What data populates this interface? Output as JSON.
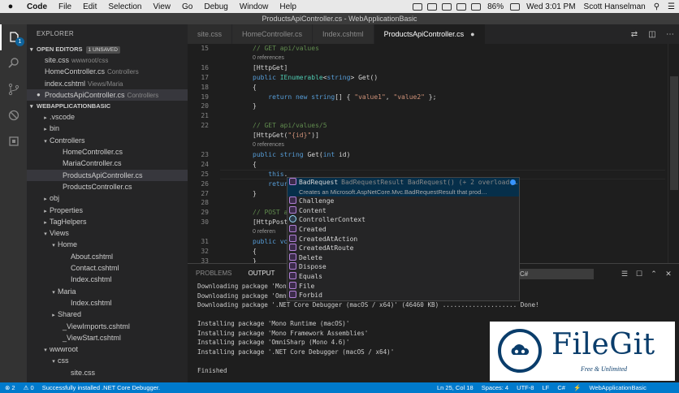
{
  "menubar": {
    "apple": "",
    "items": [
      "Code",
      "File",
      "Edit",
      "Selection",
      "View",
      "Go",
      "Debug",
      "Window",
      "Help"
    ],
    "battery": "86%",
    "clock": "Wed 3:01 PM",
    "user": "Scott Hanselman"
  },
  "window": {
    "title": "ProductsApiController.cs - WebApplicationBasic"
  },
  "activity": {
    "badge": "1"
  },
  "sidebar": {
    "title": "EXPLORER",
    "open_editors": {
      "header": "OPEN EDITORS",
      "badge": "1 UNSAVED",
      "items": [
        {
          "name": "site.css",
          "path": "wwwroot/css"
        },
        {
          "name": "HomeController.cs",
          "path": "Controllers"
        },
        {
          "name": "index.cshtml",
          "path": "Views/Maria"
        },
        {
          "name": "ProductsApiController.cs",
          "path": "Controllers"
        }
      ]
    },
    "project": {
      "header": "WEBAPPLICATIONBASIC",
      "items": [
        {
          "label": ".vscode",
          "chev": "▸"
        },
        {
          "label": "bin",
          "chev": "▸"
        },
        {
          "label": "Controllers",
          "chev": "▾"
        },
        {
          "label": "HomeController.cs",
          "chev": ""
        },
        {
          "label": "MariaController.cs",
          "chev": ""
        },
        {
          "label": "ProductsApiController.cs",
          "chev": ""
        },
        {
          "label": "ProductsController.cs",
          "chev": ""
        },
        {
          "label": "obj",
          "chev": "▸"
        },
        {
          "label": "Properties",
          "chev": "▸"
        },
        {
          "label": "TagHelpers",
          "chev": "▸"
        },
        {
          "label": "Views",
          "chev": "▾"
        },
        {
          "label": "Home",
          "chev": "▾"
        },
        {
          "label": "About.cshtml",
          "chev": ""
        },
        {
          "label": "Contact.cshtml",
          "chev": ""
        },
        {
          "label": "Index.cshtml",
          "chev": ""
        },
        {
          "label": "Maria",
          "chev": "▾"
        },
        {
          "label": "Index.cshtml",
          "chev": ""
        },
        {
          "label": "Shared",
          "chev": "▸"
        },
        {
          "label": "_ViewImports.cshtml",
          "chev": ""
        },
        {
          "label": "_ViewStart.cshtml",
          "chev": ""
        },
        {
          "label": "wwwroot",
          "chev": "▾"
        },
        {
          "label": "css",
          "chev": "▾"
        },
        {
          "label": "site.css",
          "chev": ""
        }
      ]
    }
  },
  "tabs": [
    {
      "label": "site.css"
    },
    {
      "label": "HomeController.cs"
    },
    {
      "label": "Index.cshtml"
    },
    {
      "label": "ProductsApiController.cs",
      "modified": "●"
    }
  ],
  "editor": {
    "lines": [
      {
        "n": "15",
        "tokens": [
          [
            "c",
            "// GET api/values"
          ]
        ]
      },
      {
        "n": "",
        "lens": "0 references"
      },
      {
        "n": "16",
        "tokens": [
          [
            "p",
            "[HttpGet]"
          ]
        ]
      },
      {
        "n": "17",
        "tokens": [
          [
            "k",
            "public "
          ],
          [
            "t",
            "IEnumerable"
          ],
          [
            "p",
            "<"
          ],
          [
            "k",
            "string"
          ],
          [
            "p",
            "> Get()"
          ]
        ]
      },
      {
        "n": "18",
        "tokens": [
          [
            "p",
            "{"
          ]
        ]
      },
      {
        "n": "19",
        "tokens": [
          [
            "p",
            "    "
          ],
          [
            "k",
            "return new string"
          ],
          [
            "p",
            "[] { "
          ],
          [
            "s",
            "\"value1\""
          ],
          [
            "p",
            ", "
          ],
          [
            "s",
            "\"value2\""
          ],
          [
            "p",
            " };"
          ]
        ]
      },
      {
        "n": "20",
        "tokens": [
          [
            "p",
            "}"
          ]
        ]
      },
      {
        "n": "21",
        "tokens": []
      },
      {
        "n": "22",
        "tokens": [
          [
            "c",
            "// GET api/values/5"
          ]
        ]
      },
      {
        "n": "",
        "tokens": [
          [
            "p",
            "[HttpGet("
          ],
          [
            "s",
            "\"{id}\""
          ],
          [
            "p",
            ")]"
          ]
        ]
      },
      {
        "n": "",
        "lens": "0 references"
      },
      {
        "n": "23",
        "tokens": [
          [
            "k",
            "public string "
          ],
          [
            "p",
            "Get("
          ],
          [
            "k",
            "int "
          ],
          [
            "p",
            "id)"
          ]
        ]
      },
      {
        "n": "24",
        "tokens": [
          [
            "p",
            "{"
          ]
        ]
      },
      {
        "n": "25",
        "tokens": [
          [
            "p",
            "    "
          ],
          [
            "k",
            "this"
          ],
          [
            "p",
            "."
          ]
        ]
      },
      {
        "n": "26",
        "tokens": [
          [
            "p",
            "    "
          ],
          [
            "k",
            "retur"
          ]
        ]
      },
      {
        "n": "27",
        "tokens": [
          [
            "p",
            "}"
          ]
        ]
      },
      {
        "n": "28",
        "tokens": []
      },
      {
        "n": "29",
        "tokens": [
          [
            "c",
            "// POST a"
          ]
        ]
      },
      {
        "n": "30",
        "tokens": [
          [
            "p",
            "[HttpPost"
          ]
        ]
      },
      {
        "n": "",
        "lens": "0 referen"
      },
      {
        "n": "31",
        "tokens": [
          [
            "k",
            "public vo"
          ]
        ]
      },
      {
        "n": "32",
        "tokens": [
          [
            "p",
            "{"
          ]
        ]
      },
      {
        "n": "33",
        "tokens": [
          [
            "p",
            "}"
          ]
        ]
      }
    ]
  },
  "suggest": {
    "selected": {
      "label": "BadRequest",
      "detail": "BadRequestResult BadRequest() (+ 2 overload(…"
    },
    "doc": "Creates an Microsoft.AspNetCore.Mvc.BadRequestResult that prod…",
    "items": [
      {
        "label": "Challenge",
        "icon": "method"
      },
      {
        "label": "Content",
        "icon": "method"
      },
      {
        "label": "ControllerContext",
        "icon": "prop"
      },
      {
        "label": "Created",
        "icon": "method"
      },
      {
        "label": "CreatedAtAction",
        "icon": "method"
      },
      {
        "label": "CreatedAtRoute",
        "icon": "method"
      },
      {
        "label": "Delete",
        "icon": "method"
      },
      {
        "label": "Dispose",
        "icon": "method"
      },
      {
        "label": "Equals",
        "icon": "method"
      },
      {
        "label": "File",
        "icon": "method"
      },
      {
        "label": "Forbid",
        "icon": "method"
      }
    ]
  },
  "panel": {
    "tabs": [
      {
        "label": "PROBLEMS"
      },
      {
        "label": "OUTPUT"
      }
    ],
    "select": "C#",
    "output": [
      "Downloading package 'Mono Runtime (macOS)'",
      "Downloading package 'OmniSharp (Mono 4.6)'",
      "Downloading package '.NET Core Debugger (macOS / x64)' (46460 KB) .................... Done!",
      "",
      "Installing package 'Mono Runtime (macOS)'",
      "Installing package 'Mono Framework Assemblies'",
      "Installing package 'OmniSharp (Mono 4.6)'",
      "Installing package '.NET Core Debugger (macOS / x64)'",
      "",
      "Finished"
    ]
  },
  "statusbar": {
    "left": {
      "errors": "⊗ 2",
      "warnings": "⚠ 0",
      "message": "Successfully installed .NET Core Debugger."
    },
    "right": [
      "Ln 25, Col 18",
      "Spaces: 4",
      "UTF-8",
      "LF",
      "C#",
      "⚡",
      "WebApplicationBasic"
    ]
  },
  "watermark": {
    "title": "FileGit",
    "subtitle": "Free & Unlimited"
  },
  "colors": {
    "accent": "#007acc",
    "editor_bg": "#1e1e1e",
    "sidebar_bg": "#252526",
    "activity_bg": "#333333"
  }
}
